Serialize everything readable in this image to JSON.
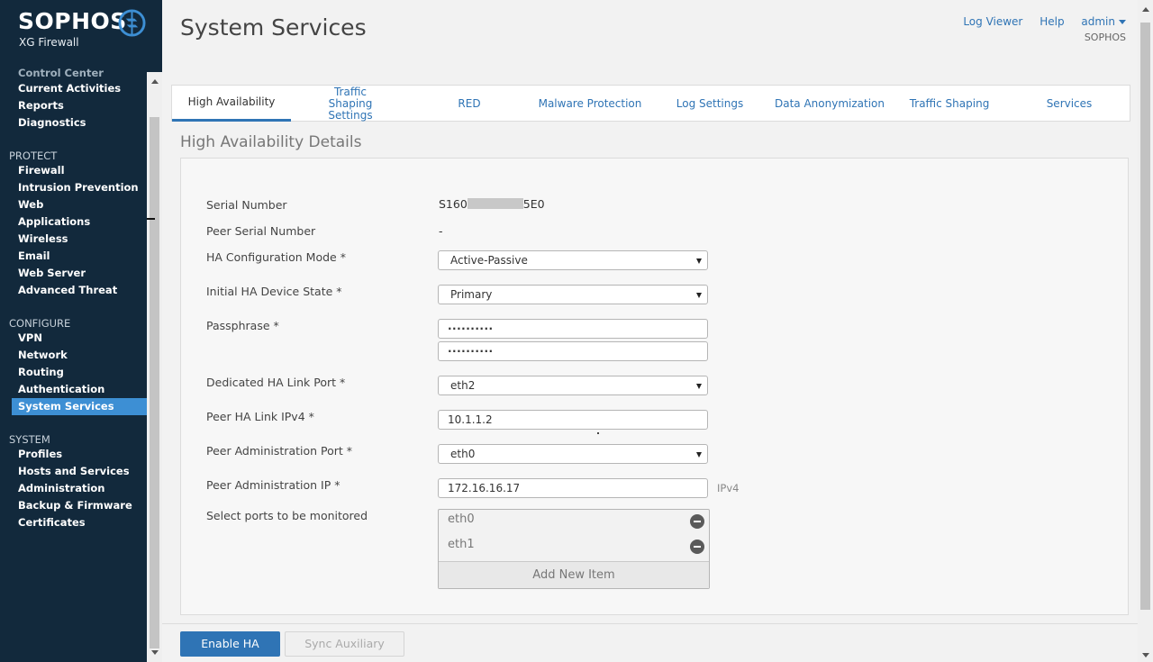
{
  "brand": {
    "name": "SOPHOS",
    "product": "XG Firewall"
  },
  "sidebar": {
    "partial_item": "Control Center",
    "monitor": [
      "Current Activities",
      "Reports",
      "Diagnostics"
    ],
    "protect": {
      "heading": "PROTECT",
      "items": [
        "Firewall",
        "Intrusion Prevention",
        "Web",
        "Applications",
        "Wireless",
        "Email",
        "Web Server",
        "Advanced Threat"
      ]
    },
    "configure": {
      "heading": "CONFIGURE",
      "items": [
        "VPN",
        "Network",
        "Routing",
        "Authentication",
        "System Services"
      ]
    },
    "system": {
      "heading": "SYSTEM",
      "items": [
        "Profiles",
        "Hosts and Services",
        "Administration",
        "Backup & Firmware",
        "Certificates"
      ]
    }
  },
  "header": {
    "title": "System Services",
    "log_viewer": "Log Viewer",
    "help": "Help",
    "user": "admin",
    "org": "SOPHOS"
  },
  "tabs": [
    {
      "label": "High Availability",
      "active": true
    },
    {
      "label": "Traffic Shaping Settings",
      "active": false
    },
    {
      "label": "RED",
      "active": false
    },
    {
      "label": "Malware Protection",
      "active": false
    },
    {
      "label": "Log Settings",
      "active": false
    },
    {
      "label": "Data Anonymization",
      "active": false
    },
    {
      "label": "Traffic Shaping",
      "active": false
    },
    {
      "label": "Services",
      "active": false
    }
  ],
  "details": {
    "title": "High Availability Details",
    "serial_label": "Serial Number",
    "serial_prefix": "S160",
    "serial_suffix": "5E0",
    "peer_serial_label": "Peer Serial Number",
    "peer_serial_value": "-",
    "ha_mode_label": "HA Configuration Mode *",
    "ha_mode_value": "Active-Passive",
    "initial_state_label": "Initial HA Device State *",
    "initial_state_value": "Primary",
    "passphrase_label": "Passphrase *",
    "passphrase_value": "··········",
    "passphrase_confirm": "··········",
    "link_port_label": "Dedicated HA Link Port *",
    "link_port_value": "eth2",
    "peer_link_label": "Peer HA Link IPv4 *",
    "peer_link_value": "10.1.1.2",
    "peer_admin_port_label": "Peer Administration Port *",
    "peer_admin_port_value": "eth0",
    "peer_admin_ip_label": "Peer Administration IP *",
    "peer_admin_ip_value": "172.16.16.17",
    "ip_type": "IPv4",
    "monitor_label": "Select ports to be monitored",
    "ports": [
      "eth0",
      "eth1"
    ],
    "add_item": "Add New Item"
  },
  "footer": {
    "enable_ha": "Enable HA",
    "sync_auxiliary": "Sync Auxiliary"
  }
}
